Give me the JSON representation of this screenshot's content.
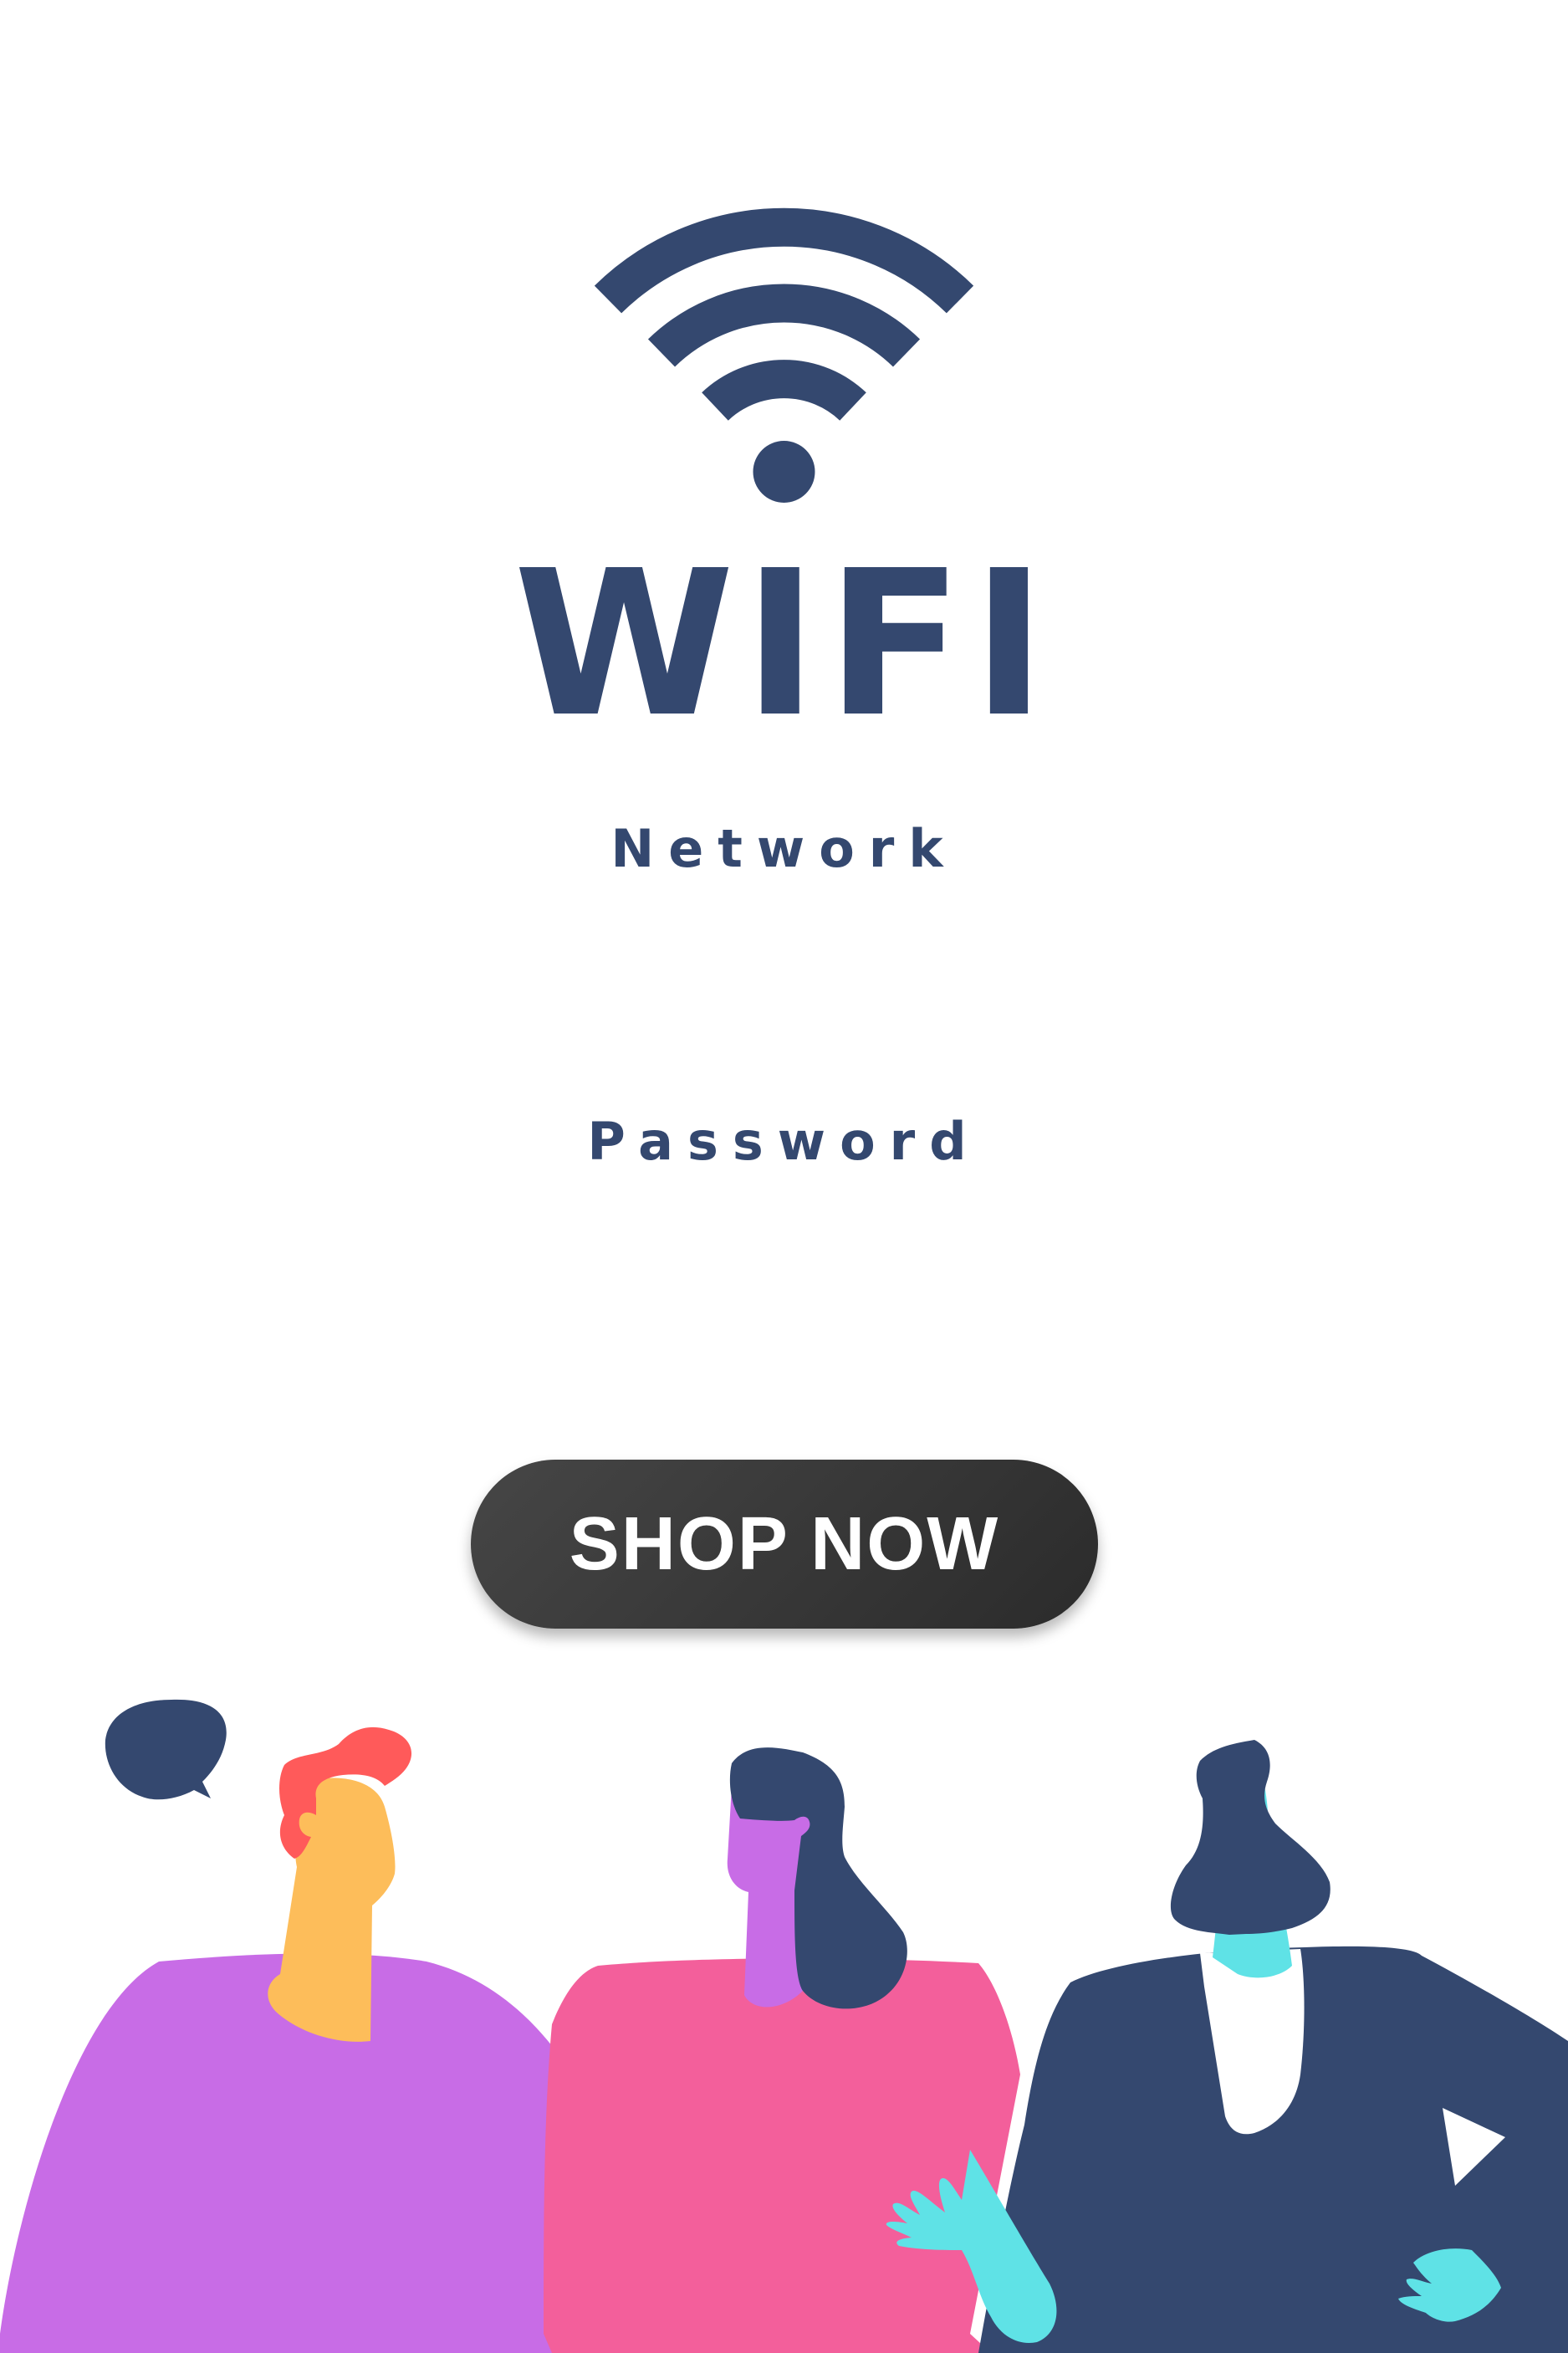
{
  "title": "WIFI",
  "network": {
    "label": "Network"
  },
  "password": {
    "label": "Password"
  },
  "cta": {
    "label": "SHOP NOW"
  },
  "icons": {
    "wifi": "wifi-signal-icon",
    "speech": "speech-bubble-icon"
  },
  "colors": {
    "navy": "#34486f",
    "purple": "#c86ce6",
    "pink": "#f35f9b",
    "cyan": "#5fe2e6",
    "orange": "#fdbd5a",
    "red": "#ff5a5a",
    "button": "#333333"
  }
}
